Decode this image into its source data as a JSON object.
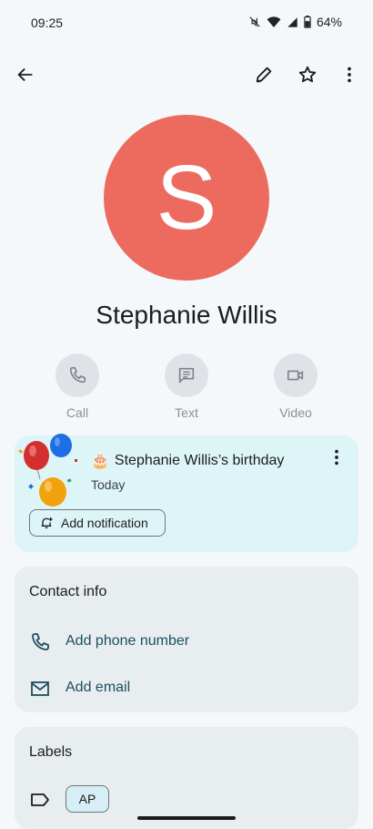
{
  "status_bar": {
    "time": "09:25",
    "battery": "64%"
  },
  "contact": {
    "initial": "S",
    "name": "Stephanie Willis",
    "avatar_color": "#ec6a5e"
  },
  "actions": [
    {
      "label": "Call",
      "icon": "phone-icon"
    },
    {
      "label": "Text",
      "icon": "message-icon"
    },
    {
      "label": "Video",
      "icon": "video-icon"
    }
  ],
  "birthday": {
    "emoji": "🎂",
    "title": "Stephanie Willis’s birthday",
    "subtitle": "Today",
    "button_label": "Add notification"
  },
  "contact_info": {
    "title": "Contact info",
    "add_phone": "Add phone number",
    "add_email": "Add email"
  },
  "labels": {
    "title": "Labels",
    "chip": "AP"
  }
}
